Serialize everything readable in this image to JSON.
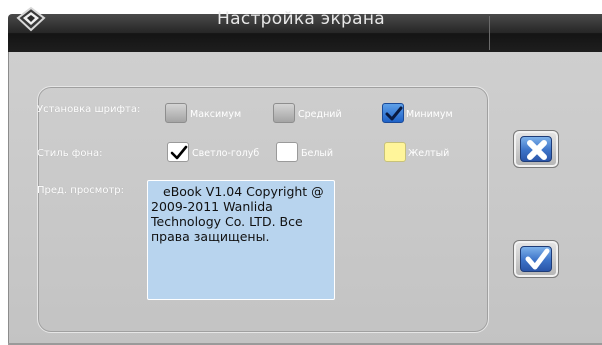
{
  "window": {
    "title": "Настройка экрана"
  },
  "font_setting": {
    "label": "Установка шрифта:",
    "options": [
      {
        "label": "Максимум",
        "checked": false
      },
      {
        "label": "Средний",
        "checked": false
      },
      {
        "label": "Минимум",
        "checked": true
      }
    ]
  },
  "background_style": {
    "label": "Стиль фона:",
    "options": [
      {
        "label": "Светло-голуб",
        "checked": true
      },
      {
        "label": "Белый",
        "checked": false
      },
      {
        "label": "Желтый",
        "checked": false
      }
    ]
  },
  "preview": {
    "label": "Пред. просмотр:",
    "text": "eBook V1.04 Copyright @ 2009-2011 Wanlida Technology Co. LTD. Все права защищены."
  },
  "buttons": {
    "cancel_icon": "close-x-icon",
    "confirm_icon": "checkmark-icon"
  },
  "colors": {
    "titlebar": "#262626",
    "panel": "#c8c8c8",
    "preview_bg": "#b8d4ee",
    "accent_blue": "#3d73c8",
    "yellow_swatch": "#fff59a"
  }
}
